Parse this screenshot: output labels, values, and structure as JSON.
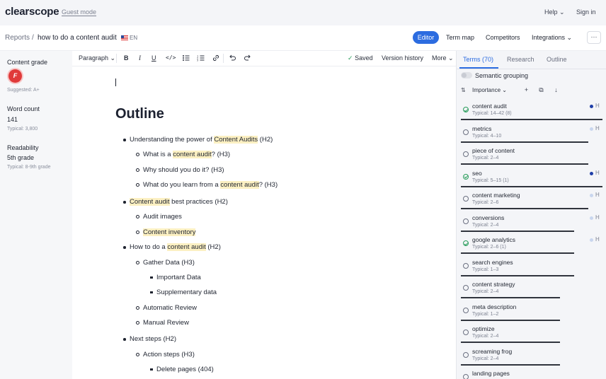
{
  "app": {
    "logo": "clearscope",
    "guest_mode": "Guest mode",
    "help": "Help",
    "sign_in": "Sign in"
  },
  "breadcrumb": {
    "reports": "Reports",
    "separator": "/",
    "title": "how to do a content audit",
    "lang": "EN"
  },
  "nav": {
    "editor": "Editor",
    "term_map": "Term map",
    "competitors": "Competitors",
    "integrations": "Integrations",
    "more": "···"
  },
  "sidebar": {
    "content_grade_label": "Content grade",
    "grade": "F",
    "suggested": "Suggested: A+",
    "word_count_label": "Word count",
    "word_count": "141",
    "word_typical": "Typical: 3,800",
    "readability_label": "Readability",
    "readability": "5th grade",
    "readability_typical": "Typical: 8-9th grade"
  },
  "toolbar": {
    "paragraph": "Paragraph",
    "saved": "Saved",
    "version_history": "Version history",
    "more": "More"
  },
  "editor": {
    "heading": "Outline",
    "items": [
      {
        "pre": "Understanding the power of ",
        "mark": "Content Audits",
        "post": " (H2)"
      },
      {
        "pre": "What is a ",
        "mark": "content audit",
        "post": "? (H3)"
      },
      {
        "pre": "Why should you do it? (H3)",
        "mark": "",
        "post": ""
      },
      {
        "pre": "What do you learn from a ",
        "mark": "content audit",
        "post": "? (H3)"
      },
      {
        "pre": "",
        "mark": "Content audit",
        "post": " best practices (H2)"
      },
      {
        "pre": "Audit images",
        "mark": "",
        "post": ""
      },
      {
        "pre": "",
        "mark": "Content inventory",
        "post": ""
      },
      {
        "pre": "How to do a ",
        "mark": "content audit",
        "post": " (H2)"
      },
      {
        "pre": "Gather Data (H3)",
        "mark": "",
        "post": ""
      },
      {
        "pre": "Important Data",
        "mark": "",
        "post": ""
      },
      {
        "pre": "Supplementary data",
        "mark": "",
        "post": ""
      },
      {
        "pre": "Automatic Review",
        "mark": "",
        "post": ""
      },
      {
        "pre": "Manual Review",
        "mark": "",
        "post": ""
      },
      {
        "pre": "Next steps (H2)",
        "mark": "",
        "post": ""
      },
      {
        "pre": "Action steps (H3)",
        "mark": "",
        "post": ""
      },
      {
        "pre": "Delete pages (404)",
        "mark": "",
        "post": ""
      }
    ]
  },
  "panel": {
    "tabs": {
      "terms": "Terms (70)",
      "research": "Research",
      "outline": "Outline"
    },
    "semantic_grouping": "Semantic grouping",
    "sort": "Importance",
    "terms": [
      {
        "name": "content audit",
        "typical": "Typical: 14–42 (8)",
        "done": true,
        "dot": "#1f3fa8",
        "h": "H",
        "progress": 1.0
      },
      {
        "name": "metrics",
        "typical": "Typical: 4–10",
        "done": false,
        "dot": "#c9d6ee",
        "h": "H",
        "progress": 0.9
      },
      {
        "name": "piece of content",
        "typical": "Typical: 2–4",
        "done": false,
        "dot": "",
        "h": "",
        "progress": 0.9
      },
      {
        "name": "seo",
        "typical": "Typical: 5–15 (1)",
        "done": true,
        "dot": "#1f3fa8",
        "h": "H",
        "progress": 1.0
      },
      {
        "name": "content marketing",
        "typical": "Typical: 2–6",
        "done": false,
        "dot": "#c9d6ee",
        "h": "H",
        "progress": 0.9
      },
      {
        "name": "conversions",
        "typical": "Typical: 2–4",
        "done": false,
        "dot": "#c9d6ee",
        "h": "H",
        "progress": 0.8
      },
      {
        "name": "google analytics",
        "typical": "Typical: 2–6 (1)",
        "done": true,
        "dot": "#c9d6ee",
        "h": "H",
        "progress": 0.8
      },
      {
        "name": "search engines",
        "typical": "Typical: 1–3",
        "done": false,
        "dot": "",
        "h": "",
        "progress": 0.8
      },
      {
        "name": "content strategy",
        "typical": "Typical: 2–4",
        "done": false,
        "dot": "",
        "h": "",
        "progress": 0.7
      },
      {
        "name": "meta description",
        "typical": "Typical: 1–2",
        "done": false,
        "dot": "",
        "h": "",
        "progress": 0.7
      },
      {
        "name": "optimize",
        "typical": "Typical: 2–4",
        "done": false,
        "dot": "",
        "h": "",
        "progress": 0.7
      },
      {
        "name": "screaming frog",
        "typical": "Typical: 2–4",
        "done": false,
        "dot": "",
        "h": "",
        "progress": 0.7
      },
      {
        "name": "landing pages",
        "typical": "",
        "done": false,
        "dot": "",
        "h": "",
        "progress": 0.0
      }
    ]
  }
}
